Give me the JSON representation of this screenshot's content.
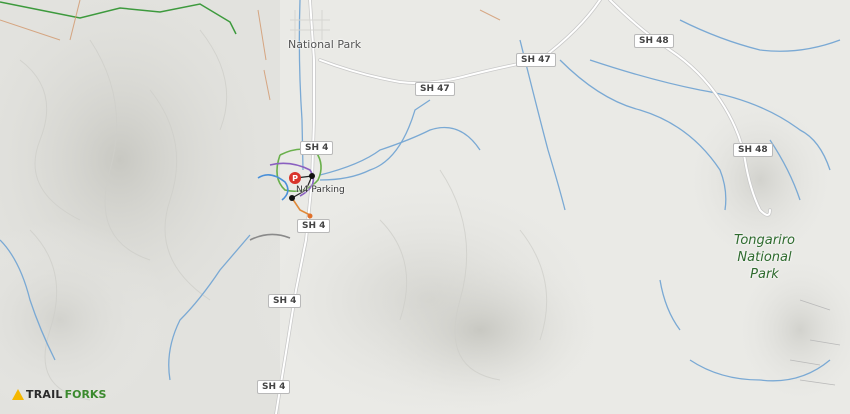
{
  "map": {
    "places": [
      {
        "id": "national-park",
        "text": "National Park"
      }
    ],
    "park_label": "Tongariro\nNational\nPark",
    "parking_label": "N4 Parking",
    "roads": [
      {
        "id": "sh47-a",
        "text": "SH 47"
      },
      {
        "id": "sh47-b",
        "text": "SH 47"
      },
      {
        "id": "sh48-a",
        "text": "SH 48"
      },
      {
        "id": "sh48-b",
        "text": "SH 48"
      },
      {
        "id": "sh4-a",
        "text": "SH 4"
      },
      {
        "id": "sh4-b",
        "text": "SH 4"
      },
      {
        "id": "sh4-c",
        "text": "SH 4"
      },
      {
        "id": "sh4-d",
        "text": "SH 4"
      }
    ],
    "logo": {
      "part1": "TRAIL",
      "part2": "FORKS"
    },
    "colors": {
      "water": "#7aa9d4",
      "road": "#ffffff",
      "trail_green": "#6ab04c",
      "trail_purple": "#8a5fc0",
      "trail_blue": "#4a90d9",
      "parking_red": "#d9342b",
      "park_boundary": "#3d9a3d"
    }
  }
}
